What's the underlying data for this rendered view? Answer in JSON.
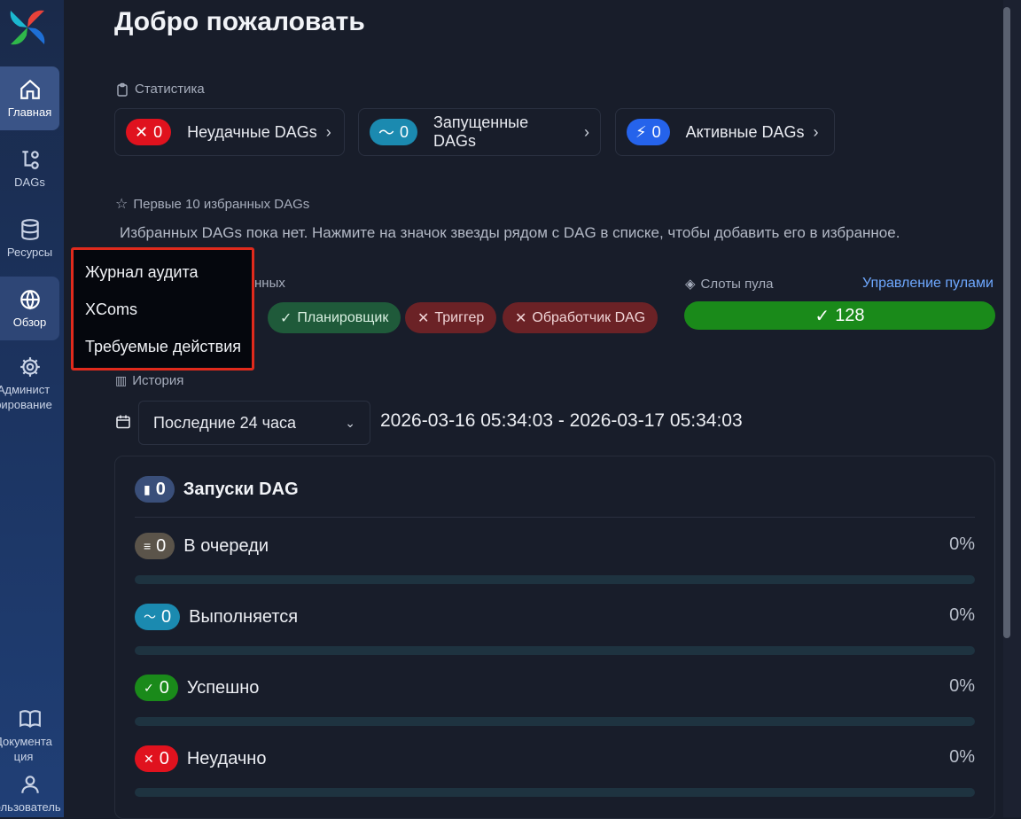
{
  "sidebar": {
    "items": [
      {
        "label": "Главная",
        "icon": "home-icon"
      },
      {
        "label": "DAGs",
        "icon": "dag-icon"
      },
      {
        "label": "Ресурсы",
        "icon": "database-icon"
      },
      {
        "label": "Обзор",
        "icon": "globe-icon"
      },
      {
        "label": "Админист рирование",
        "icon": "gear-icon"
      }
    ],
    "bottom": [
      {
        "label": "Документа ция",
        "icon": "book-icon"
      },
      {
        "label": "Пользователь",
        "icon": "user-icon"
      }
    ]
  },
  "page": {
    "title": "Добро пожаловать"
  },
  "stats": {
    "label": "Статистика",
    "cards": [
      {
        "count": "0",
        "label": "Неудачные DAGs",
        "color": "#e0121e"
      },
      {
        "count": "0",
        "label": "Запущенные DAGs",
        "color": "#1b8ab0"
      },
      {
        "count": "0",
        "label": "Активные DAGs",
        "color": "#2563eb"
      }
    ]
  },
  "favorites": {
    "label": "Первые 10 избранных DAGs",
    "empty_text": "Избранных DAGs пока нет. Нажмите на значок звезды рядом с DAG в списке, чтобы добавить его в избранное."
  },
  "health": {
    "label_tail": "нных",
    "items": [
      {
        "label": "Планировщик",
        "status": "ok"
      },
      {
        "label": "Триггер",
        "status": "error"
      },
      {
        "label": "Обработчик DAG",
        "status": "error"
      }
    ]
  },
  "pool": {
    "label": "Слоты пула",
    "link": "Управление пулами",
    "value": "128",
    "color": "#1a8a1a"
  },
  "history": {
    "label": "История",
    "range_select": "Последние 24 часа",
    "range_text": "2026-03-16 05:34:03 - 2026-03-17 05:34:03"
  },
  "runs": {
    "title": "Запуски DAG",
    "count": "0",
    "rows": [
      {
        "label": "В очереди",
        "count": "0",
        "pct": "0%",
        "progress": 0,
        "color": "#5b544a"
      },
      {
        "label": "Выполняется",
        "count": "0",
        "pct": "0%",
        "progress": 0,
        "color": "#1b8ab0"
      },
      {
        "label": "Успешно",
        "count": "0",
        "pct": "0%",
        "progress": 0,
        "color": "#1a8a1a"
      },
      {
        "label": "Неудачно",
        "count": "0",
        "pct": "0%",
        "progress": 0,
        "color": "#e0121e"
      }
    ]
  },
  "menu": {
    "items": [
      "Журнал аудита",
      "XComs",
      "Требуемые действия"
    ]
  }
}
